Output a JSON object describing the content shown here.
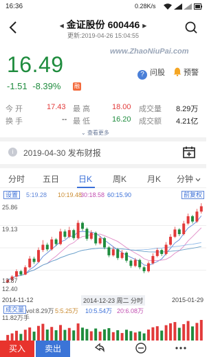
{
  "status": {
    "time": "16:36",
    "net_speed": "0.28K/s"
  },
  "header": {
    "stock_name": "金证股份",
    "stock_code": "600446",
    "updated": "更新:2019-04-26 15:04:55"
  },
  "watermark": "www.ZhaoNiuPai.com",
  "quote": {
    "price": "16.49",
    "change": "-1.51",
    "change_pct": "-8.39%",
    "margin_badge": "融",
    "ask_label": "问股",
    "alert_label": "预警"
  },
  "stats": {
    "open_label": "今  开",
    "open_value": "17.43",
    "high_label": "最  高",
    "high_value": "18.00",
    "volume_label": "成交量",
    "volume_value": "8.29万",
    "turnover_label": "换  手",
    "turnover_value": "--",
    "low_label": "最  低",
    "low_value": "16.20",
    "amount_label": "成交额",
    "amount_value": "4.21亿",
    "more_label": "查看更多"
  },
  "report": {
    "text": "2019-04-30 发布财报"
  },
  "tabs": [
    "分时",
    "五日",
    "日K",
    "周K",
    "月K",
    "分钟"
  ],
  "active_tab": "日K",
  "ma_bar": {
    "settings_label": "设置",
    "ma5": "5:19.28",
    "ma10": "10:19.48",
    "ma30": "30:18.58",
    "ma60": "60:15.90",
    "adjust_label": "前复权"
  },
  "chart_data": {
    "type": "candlestick",
    "y_ticks": [
      "25.86",
      "19.13",
      "13.87",
      "12.40"
    ],
    "x_labels": [
      "2014-11-12",
      "2014-12-23 周二 分时",
      "2015-01-29"
    ],
    "ylim": [
      12.4,
      25.86
    ],
    "colors": {
      "up": "#e23a3a",
      "down": "#1f8c3e",
      "ma5": "#5e86d9",
      "ma10": "#e08ac6",
      "ma30": "#8fb9e8",
      "ma60": "#6aa0c8"
    },
    "candles": [
      {
        "o": 13.9,
        "c": 14.3,
        "h": 14.5,
        "l": 13.8
      },
      {
        "o": 14.3,
        "c": 14.8,
        "h": 15.0,
        "l": 14.1
      },
      {
        "o": 14.8,
        "c": 15.6,
        "h": 15.9,
        "l": 14.6
      },
      {
        "o": 15.6,
        "c": 15.1,
        "h": 15.8,
        "l": 14.9
      },
      {
        "o": 15.1,
        "c": 16.2,
        "h": 16.5,
        "l": 15.0
      },
      {
        "o": 16.2,
        "c": 17.5,
        "h": 17.9,
        "l": 16.0
      },
      {
        "o": 17.5,
        "c": 17.0,
        "h": 17.8,
        "l": 16.7
      },
      {
        "o": 17.0,
        "c": 18.8,
        "h": 19.2,
        "l": 16.9
      },
      {
        "o": 18.8,
        "c": 19.6,
        "h": 20.3,
        "l": 18.5
      },
      {
        "o": 19.6,
        "c": 18.9,
        "h": 19.9,
        "l": 18.6
      },
      {
        "o": 18.9,
        "c": 20.4,
        "h": 20.8,
        "l": 18.7
      },
      {
        "o": 20.4,
        "c": 19.7,
        "h": 20.6,
        "l": 19.4
      },
      {
        "o": 19.7,
        "c": 21.6,
        "h": 22.0,
        "l": 19.5
      },
      {
        "o": 21.6,
        "c": 20.8,
        "h": 21.9,
        "l": 20.5
      },
      {
        "o": 20.8,
        "c": 21.8,
        "h": 22.3,
        "l": 20.6
      },
      {
        "o": 21.8,
        "c": 20.6,
        "h": 22.0,
        "l": 20.3
      },
      {
        "o": 20.6,
        "c": 22.9,
        "h": 23.3,
        "l": 20.4
      },
      {
        "o": 22.9,
        "c": 22.0,
        "h": 23.1,
        "l": 21.7
      },
      {
        "o": 22.0,
        "c": 20.5,
        "h": 22.2,
        "l": 20.2
      },
      {
        "o": 20.5,
        "c": 21.4,
        "h": 21.8,
        "l": 20.3
      },
      {
        "o": 21.4,
        "c": 19.8,
        "h": 21.6,
        "l": 19.5
      },
      {
        "o": 19.8,
        "c": 20.6,
        "h": 20.9,
        "l": 19.6
      },
      {
        "o": 20.6,
        "c": 19.2,
        "h": 20.8,
        "l": 18.9
      },
      {
        "o": 19.2,
        "c": 18.0,
        "h": 19.4,
        "l": 17.7
      },
      {
        "o": 18.0,
        "c": 18.9,
        "h": 19.3,
        "l": 17.8
      },
      {
        "o": 18.9,
        "c": 17.6,
        "h": 19.1,
        "l": 17.3
      },
      {
        "o": 17.6,
        "c": 18.4,
        "h": 18.8,
        "l": 17.4
      },
      {
        "o": 18.4,
        "c": 17.2,
        "h": 18.6,
        "l": 16.9
      },
      {
        "o": 17.2,
        "c": 16.4,
        "h": 17.4,
        "l": 16.1
      },
      {
        "o": 16.4,
        "c": 17.3,
        "h": 17.6,
        "l": 16.2
      },
      {
        "o": 17.3,
        "c": 16.2,
        "h": 17.5,
        "l": 15.9
      },
      {
        "o": 16.2,
        "c": 15.6,
        "h": 16.4,
        "l": 15.3
      },
      {
        "o": 15.6,
        "c": 16.8,
        "h": 17.1,
        "l": 15.4
      },
      {
        "o": 16.8,
        "c": 17.9,
        "h": 18.3,
        "l": 16.6
      },
      {
        "o": 17.9,
        "c": 18.8,
        "h": 19.1,
        "l": 17.7
      },
      {
        "o": 18.8,
        "c": 18.2,
        "h": 19.0,
        "l": 17.9
      },
      {
        "o": 18.2,
        "c": 19.6,
        "h": 20.0,
        "l": 18.0
      },
      {
        "o": 19.6,
        "c": 20.8,
        "h": 21.2,
        "l": 19.4
      },
      {
        "o": 20.8,
        "c": 21.9,
        "h": 22.3,
        "l": 20.6
      },
      {
        "o": 21.9,
        "c": 21.2,
        "h": 22.1,
        "l": 20.9
      },
      {
        "o": 21.2,
        "c": 22.8,
        "h": 23.2,
        "l": 21.0
      },
      {
        "o": 22.8,
        "c": 23.9,
        "h": 24.3,
        "l": 22.6
      },
      {
        "o": 23.9,
        "c": 23.1,
        "h": 24.1,
        "l": 22.8
      },
      {
        "o": 23.1,
        "c": 24.6,
        "h": 25.0,
        "l": 22.9
      },
      {
        "o": 24.6,
        "c": 25.4,
        "h": 25.86,
        "l": 24.3
      }
    ]
  },
  "vol_bar": {
    "label": "成交量",
    "vol": "vol:8.29万",
    "ma5": "5:5.25万",
    "ma10": "10:5.54万",
    "ma20": "20:6.08万",
    "max_label": "11.82万手"
  },
  "volume_data": [
    3.2,
    4.1,
    5.6,
    3.8,
    6.2,
    7.5,
    5.1,
    8.4,
    9.6,
    6.3,
    7.8,
    5.9,
    8.9,
    6.1,
    7.2,
    5.8,
    9.8,
    7.4,
    6.6,
    5.3,
    6.9,
    5.1,
    6.4,
    7.1,
    4.8,
    5.9,
    4.3,
    6.2,
    5.4,
    4.6,
    5.2,
    4.1,
    6.3,
    7.6,
    8.2,
    5.7,
    8.8,
    9.9,
    10.6,
    7.3,
    9.4,
    11.2,
    8.1,
    10.1,
    11.82
  ],
  "toolbar": {
    "buy_label": "买入",
    "sell_label": "卖出"
  }
}
